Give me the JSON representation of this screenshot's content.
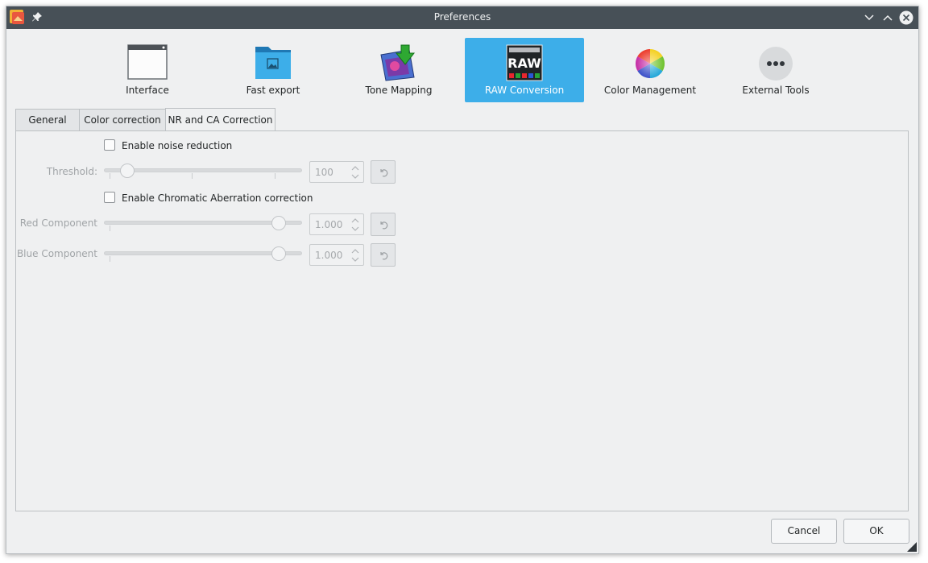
{
  "window": {
    "title": "Preferences"
  },
  "pages": [
    {
      "label": "Interface",
      "icon": "window-icon"
    },
    {
      "label": "Fast export",
      "icon": "folder-image-icon"
    },
    {
      "label": "Tone Mapping",
      "icon": "tone-mapping-icon"
    },
    {
      "label": "RAW Conversion",
      "icon": "raw-icon",
      "icon_text": "RAW",
      "active": true
    },
    {
      "label": "Color Management",
      "icon": "color-wheel-icon"
    },
    {
      "label": "External Tools",
      "icon": "more-dots-icon"
    }
  ],
  "tabs": [
    {
      "label": "General"
    },
    {
      "label": "Color correction"
    },
    {
      "label": "NR and CA Correction",
      "active": true
    }
  ],
  "nr": {
    "enable_label": "Enable noise reduction",
    "enabled": false,
    "threshold_label": "Threshold:",
    "threshold_value": "100"
  },
  "ca": {
    "enable_label": "Enable Chromatic Aberration correction",
    "enabled": false,
    "red_label": "Red Component",
    "red_value": "1.000",
    "blue_label": "Blue Component",
    "blue_value": "1.000"
  },
  "buttons": {
    "cancel": "Cancel",
    "ok": "OK"
  },
  "colors": {
    "accent": "#3daee9",
    "titlebar": "#475057",
    "background": "#eff0f1"
  }
}
